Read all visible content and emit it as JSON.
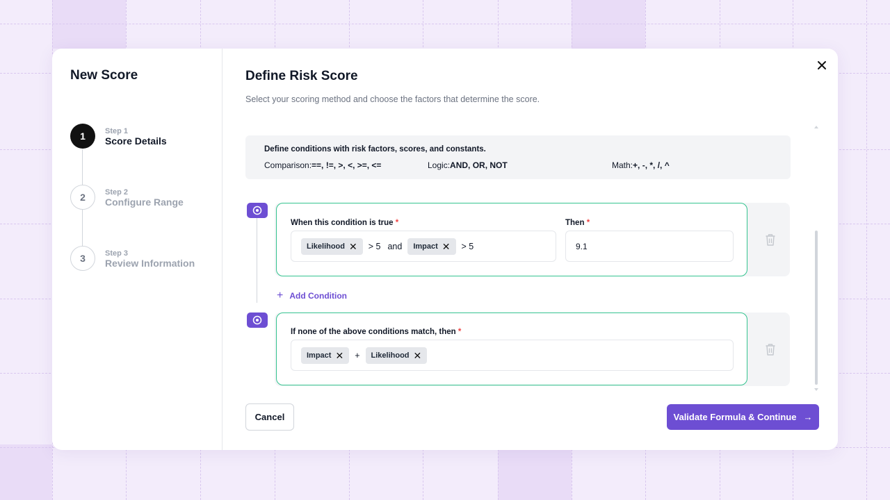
{
  "sidebar": {
    "title": "New Score",
    "steps": [
      {
        "number": "1",
        "small": "Step 1",
        "label": "Score Details",
        "state": "active"
      },
      {
        "number": "2",
        "small": "Step 2",
        "label": "Configure Range",
        "state": "inactive"
      },
      {
        "number": "3",
        "small": "Step 3",
        "label": "Review Information",
        "state": "inactive"
      }
    ]
  },
  "main": {
    "title": "Define Risk Score",
    "subtitle": "Select your scoring method and choose the factors that determine the score.",
    "info": {
      "heading": "Define conditions with risk factors, scores, and constants.",
      "comparison_label": "Comparison:",
      "comparison_ops": "==, !=, >, <, >=, <=",
      "logic_label": "Logic:",
      "logic_ops": "AND, OR, NOT",
      "math_label": "Math:",
      "math_ops": "+, -, *, /, ^"
    },
    "condition": {
      "when_label": "When this condition is true",
      "then_label": "Then",
      "required": "*",
      "chip1": "Likelihood",
      "op1": "> 5",
      "joiner": "and",
      "chip2": "Impact",
      "op2": "> 5",
      "then_value": "9.1"
    },
    "add_condition": "Add Condition",
    "fallback": {
      "label": "If none of the above conditions match, then",
      "required": "*",
      "chip1": "Impact",
      "op": "+",
      "chip2": "Likelihood"
    }
  },
  "footer": {
    "cancel": "Cancel",
    "continue": "Validate Formula & Continue",
    "continue_arrow": "→"
  },
  "colors": {
    "accent": "#6d4ed3",
    "card_border": "#34c38f",
    "required": "#ef4444",
    "background": "#f3ecfb"
  },
  "icons": [
    "close-icon",
    "target-icon",
    "trash-icon",
    "plus-icon",
    "chip-remove-icon",
    "arrow-right-icon"
  ]
}
